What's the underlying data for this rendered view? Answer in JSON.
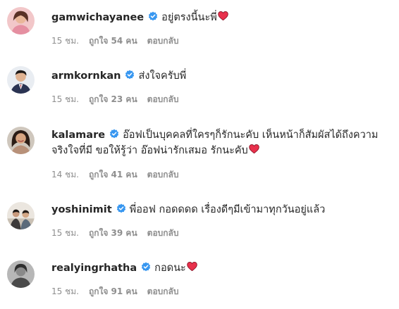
{
  "colors": {
    "verified_blue": "#3897f0",
    "heart_red": "#e8314c",
    "meta_gray": "#8e8e8e",
    "text": "#262626"
  },
  "comments": [
    {
      "username": "gamwichayanee",
      "text": "อยู่ตรงนี้นะพี่",
      "heart": true,
      "time": "15 ชม.",
      "likes": "ถูกใจ 54 คน",
      "reply": "ตอบกลับ"
    },
    {
      "username": "armkornkan",
      "text": "ส่งใจครับพี่",
      "heart": false,
      "time": "15 ชม.",
      "likes": "ถูกใจ 23 คน",
      "reply": "ตอบกลับ"
    },
    {
      "username": "kalamare",
      "text": "อ๊อฟเป็นบุคคลที่ใครๆก็รักนะคับ เห็นหน้าก็สัมผัสได้ถึงความจริงใจที่มี ขอให้รู้ว่า อ๊อฟน่ารักเสมอ รักนะคับ",
      "heart": true,
      "time": "14 ชม.",
      "likes": "ถูกใจ 41 คน",
      "reply": "ตอบกลับ"
    },
    {
      "username": "yoshinimit",
      "text": "พี่ออฟ กอดดดด เรื่องดีๆมีเข้ามาทุกวันอยู่แล้ว",
      "heart": false,
      "time": "15 ชม.",
      "likes": "ถูกใจ 39 คน",
      "reply": "ตอบกลับ"
    },
    {
      "username": "realyingrhatha",
      "text": "กอดนะ",
      "heart": true,
      "time": "15 ชม.",
      "likes": "ถูกใจ 91 คน",
      "reply": "ตอบกลับ"
    }
  ]
}
